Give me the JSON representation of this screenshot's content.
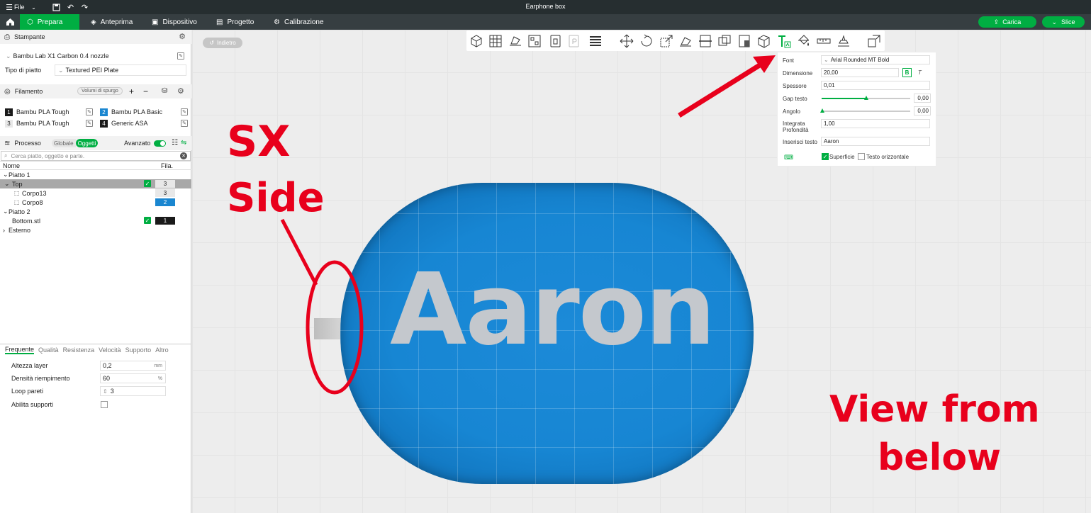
{
  "window": {
    "title": "Earphone box",
    "file_menu": "File"
  },
  "nav": {
    "tabs": [
      "Prepara",
      "Anteprima",
      "Dispositivo",
      "Progetto",
      "Calibrazione"
    ],
    "upload": "Carica",
    "slice": "Slice"
  },
  "sidebar": {
    "printer": {
      "title": "Stampante",
      "name": "Bambu Lab X1 Carbon 0.4 nozzle",
      "plate_label": "Tipo di piatto",
      "plate_value": "Textured PEI Plate"
    },
    "filament": {
      "title": "Filamento",
      "purge_button": "Volumi di spurgo",
      "items": [
        {
          "num": "1",
          "name": "Bambu PLA Tough",
          "color": "#1a1a1a"
        },
        {
          "num": "2",
          "name": "Bambu PLA Basic",
          "color": "#1a86d0"
        },
        {
          "num": "3",
          "name": "Bambu PLA Tough",
          "color": "#e8e8e8"
        },
        {
          "num": "4",
          "name": "Generic ASA",
          "color": "#1a1a1a"
        }
      ]
    },
    "process": {
      "title": "Processo",
      "global": "Globale",
      "objects": "Oggetti",
      "advanced": "Avanzato",
      "search_placeholder": "Cerca piatto, oggetto e parte.",
      "col_name": "Nome",
      "col_fila": "Fila.",
      "tree": [
        {
          "label": "Piatto 1"
        },
        {
          "label": "Top",
          "fila": "3"
        },
        {
          "label": "Corpo13",
          "fila": "3"
        },
        {
          "label": "Corpo8",
          "fila": "2"
        },
        {
          "label": "Piatto 2"
        },
        {
          "label": "Bottom.stl",
          "fila": "1"
        },
        {
          "label": "Esterno"
        }
      ]
    },
    "param_tabs": [
      "Frequente",
      "Qualità",
      "Resistenza",
      "Velocità",
      "Supporto",
      "Altro"
    ],
    "params": [
      {
        "label": "Altezza layer",
        "value": "0,2",
        "unit": "mm"
      },
      {
        "label": "Densità riempimento",
        "value": "60",
        "unit": "%"
      },
      {
        "label": "Loop pareti",
        "value": "3"
      },
      {
        "label": "Abilita supporti"
      }
    ]
  },
  "canvas": {
    "back": "Indietro",
    "model_text": "Aaron"
  },
  "text_panel": {
    "font_label": "Font",
    "font_value": "Arial Rounded MT Bold",
    "size_label": "Dimensione",
    "size_value": "20,00",
    "bold": "B",
    "italic": "T",
    "thickness_label": "Spessore",
    "thickness_value": "0,01",
    "gap_label": "Gap testo",
    "gap_value": "0,00",
    "angle_label": "Angolo",
    "angle_value": "0,00",
    "depth_label_1": "Integrata",
    "depth_label_2": "Profondità",
    "depth_value": "1,00",
    "text_label": "Inserisci testo",
    "text_value": "Aaron",
    "surface_label": "Superficie",
    "horizontal_label": "Testo orizzontale"
  },
  "annotations": {
    "sx": "SX",
    "side": "Side",
    "view_1": "View from",
    "view_2": "below"
  },
  "colors": {
    "accent": "#00ae42",
    "annotation": "#e8001c",
    "model": "#1786d3"
  }
}
